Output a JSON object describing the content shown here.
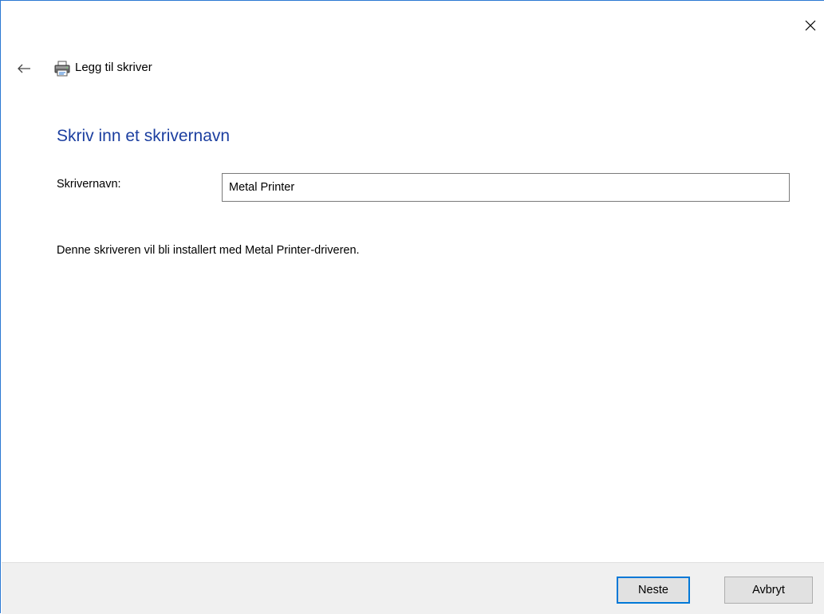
{
  "window": {
    "title": "Legg til skriver",
    "accent_color": "#2b78d3"
  },
  "header": {
    "back_icon": "arrow-left-icon",
    "app_icon": "printer-icon",
    "close_icon": "close-icon"
  },
  "main": {
    "heading": "Skriv inn et skrivernavn",
    "heading_color": "#1c3fa0",
    "name_label": "Skrivernavn:",
    "name_value": "Metal Printer",
    "info_text": "Denne skriveren vil bli installert med Metal Printer-driveren."
  },
  "footer": {
    "next_label": "Neste",
    "cancel_label": "Avbryt"
  }
}
